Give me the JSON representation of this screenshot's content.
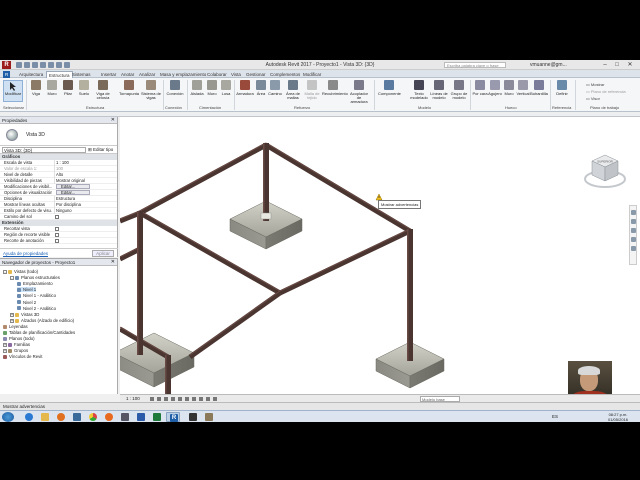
{
  "window": {
    "title": "Autodesk Revit 2017 -   Proyecto1 - Vista 3D: {3D}",
    "search_placeholder": "Escriba palabra clave o frase",
    "user": "vmuanne@gm...",
    "app_letter": "R"
  },
  "tabs": [
    "Arquitectura",
    "Estructura",
    "Sistemas",
    "Insertar",
    "Anotar",
    "Analizar",
    "Masa y emplazamiento",
    "Colaborar",
    "Vista",
    "Gestionar",
    "Complementos",
    "Modificar"
  ],
  "ribbon": {
    "modify_label": "Modificar",
    "buttons": [
      "Viga",
      "Muro",
      "Pilar",
      "Suelo",
      "Viga de celosía",
      "Tornapunta",
      "Sistema de vigas",
      "Conexión",
      "Aislada",
      "Muro",
      "Losa",
      "Armadura",
      "Área",
      "Camino",
      "Área de mallas",
      "Malla de tejido",
      "Recubrimiento",
      "Acoplador de armadura",
      "Componente",
      "Texto modelado",
      "Líneas de modelo",
      "Grupo de modelo",
      "Por cara",
      "Agujero",
      "Muro",
      "Vertical",
      "Buhardilla",
      "Definir",
      "Mostrar",
      "Plano de referencia",
      "Visor"
    ],
    "panels": [
      "Seleccionar",
      "Estructura",
      "Conexión",
      "Cimentación",
      "Refuerzo",
      "Modelo",
      "Hueco",
      "Referencia",
      "Plano de trabajo"
    ]
  },
  "properties": {
    "title": "Propiedades",
    "type_name": "Vista 3D",
    "instance": "Vista 3D: {3D}",
    "edit_type": "Editar tipo",
    "groups": [
      {
        "name": "Gráficos",
        "rows": [
          {
            "label": "Escala de vista",
            "value": "1 : 100"
          },
          {
            "label": "Valor de escala    1:",
            "value": "100"
          },
          {
            "label": "Nivel de detalle",
            "value": "Alto"
          },
          {
            "label": "Visibilidad de piezas",
            "value": "Mostrar original"
          },
          {
            "label": "Modificaciones de visibil...",
            "value": "Editar..."
          },
          {
            "label": "Opciones de visualización...",
            "value": "Editar..."
          },
          {
            "label": "Disciplina",
            "value": "Estructura"
          },
          {
            "label": "Mostrar líneas ocultas",
            "value": "Por disciplina"
          },
          {
            "label": "Estilo por defecto de visu...",
            "value": "Ninguno"
          },
          {
            "label": "Camino del sol",
            "value": ""
          }
        ]
      },
      {
        "name": "Extensión",
        "rows": [
          {
            "label": "Recortar vista",
            "value": ""
          },
          {
            "label": "Región de recorte visible",
            "value": ""
          },
          {
            "label": "Recorte de anotación",
            "value": ""
          }
        ]
      }
    ],
    "help_link": "Ayuda de propiedades",
    "apply": "Aplicar"
  },
  "browser": {
    "title": "Navegador de proyectos - Proyecto1",
    "items": [
      {
        "label": "Vistas (todo)",
        "level": 0,
        "toggle": "-"
      },
      {
        "label": "Planos estructurales",
        "level": 1,
        "toggle": "-"
      },
      {
        "label": "Emplazamiento",
        "level": 2,
        "toggle": ""
      },
      {
        "label": "Nivel 1",
        "level": 2,
        "toggle": "",
        "selected": true
      },
      {
        "label": "Nivel 1 - Análitico",
        "level": 2,
        "toggle": ""
      },
      {
        "label": "Nivel 2",
        "level": 2,
        "toggle": ""
      },
      {
        "label": "Nivel 2 - Análitico",
        "level": 2,
        "toggle": ""
      },
      {
        "label": "Vistas 3D",
        "level": 1,
        "toggle": "+"
      },
      {
        "label": "Alzados (Alzado de edificio)",
        "level": 1,
        "toggle": "+"
      },
      {
        "label": "Leyendas",
        "level": 0,
        "toggle": ""
      },
      {
        "label": "Tablas de planificación/Cantidades",
        "level": 0,
        "toggle": ""
      },
      {
        "label": "Planos (todo)",
        "level": 0,
        "toggle": ""
      },
      {
        "label": "Familias",
        "level": 0,
        "toggle": "+"
      },
      {
        "label": "Grupos",
        "level": 0,
        "toggle": "+"
      },
      {
        "label": "Vínculos de Revit",
        "level": 0,
        "toggle": ""
      }
    ]
  },
  "viewport": {
    "tooltip": "Mostrar advertencias",
    "cube_face": "SUPERIOR"
  },
  "viewbar": {
    "scale": "1 : 100",
    "model": "Modelo base"
  },
  "status": {
    "text": "Mostrar advertencias"
  },
  "taskbar": {
    "lang": "ES",
    "time": "08:27 p.m.",
    "date": "01/05/2016"
  },
  "colors": {
    "steel": "#4a3530",
    "steel_light": "#6a4a44",
    "concrete": "#b8b8ae",
    "ribbon_blue": "#1f5fa8"
  }
}
